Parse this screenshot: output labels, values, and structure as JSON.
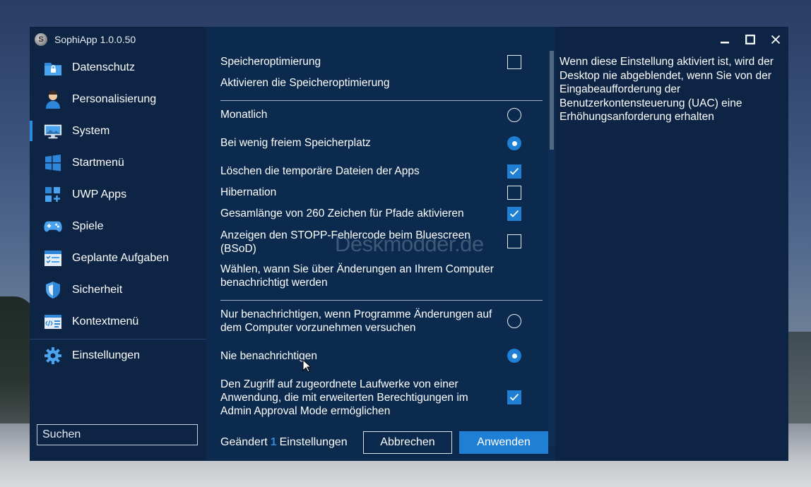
{
  "app": {
    "title": "SophiApp 1.0.0.50",
    "logo_letter": "S"
  },
  "sidebar": {
    "items": [
      {
        "label": "Datenschutz",
        "icon": "privacy-folder-icon"
      },
      {
        "label": "Personalisierung",
        "icon": "person-icon"
      },
      {
        "label": "System",
        "icon": "monitor-icon",
        "active": true
      },
      {
        "label": "Startmenü",
        "icon": "windows-tiles-icon"
      },
      {
        "label": "UWP Apps",
        "icon": "apps-grid-icon"
      },
      {
        "label": "Spiele",
        "icon": "gamepad-icon"
      },
      {
        "label": "Geplante Aufgaben",
        "icon": "tasks-list-icon"
      },
      {
        "label": "Sicherheit",
        "icon": "shield-icon"
      },
      {
        "label": "Kontextmenü",
        "icon": "code-menu-icon"
      }
    ],
    "settings_label": "Einstellungen",
    "search_placeholder": "Suchen"
  },
  "main": {
    "rows": [
      {
        "label": "Speicheroptimierung",
        "control": "checkbox",
        "checked": false
      },
      {
        "label": "Aktivieren die Speicheroptimierung",
        "control": "none"
      },
      {
        "label": "Monatlich",
        "control": "radio",
        "checked": false
      },
      {
        "label": "Bei wenig freiem Speicherplatz",
        "control": "radio",
        "checked": true
      },
      {
        "label": "Löschen die temporäre Dateien der Apps",
        "control": "checkbox",
        "checked": true
      },
      {
        "label": "Hibernation",
        "control": "checkbox",
        "checked": false
      },
      {
        "label": "Gesamlänge von 260 Zeichen für Pfade aktivieren",
        "control": "checkbox",
        "checked": true
      },
      {
        "label": "Anzeigen den STOPP-Fehlercode beim Bluescreen (BSoD)",
        "control": "checkbox",
        "checked": false
      },
      {
        "label": "Wählen, wann Sie über Änderungen an Ihrem Computer benachrichtigt werden",
        "control": "none"
      },
      {
        "label": "Nur benachrichtigen, wenn Programme Änderungen auf dem Computer vorzunehmen versuchen",
        "control": "radio",
        "checked": false
      },
      {
        "label": "Nie benachrichtigen",
        "control": "radio",
        "checked": true
      },
      {
        "label": "Den Zugriff auf zugeordnete Laufwerke von einer Anwendung, die mit erweiterten Berechtigungen im Admin Approval Mode ermöglichen",
        "control": "checkbox",
        "checked": true
      }
    ],
    "footer": {
      "changed_prefix": "Geändert",
      "changed_count": "1",
      "changed_suffix": "Einstellungen",
      "cancel_label": "Abbrechen",
      "apply_label": "Anwenden"
    }
  },
  "description": {
    "text": "Wenn diese Einstellung aktiviert ist, wird der Desktop nie abgeblendet, wenn Sie von der Eingabeaufforderung der Benutzerkontensteuerung (UAC) eine Erhöhungsanforderung erhalten"
  },
  "watermark": "Deskmodder.de",
  "colors": {
    "accent": "#1f7fd4",
    "sidebar_bg": "#0d2444",
    "main_bg": "#0b2a4d"
  }
}
